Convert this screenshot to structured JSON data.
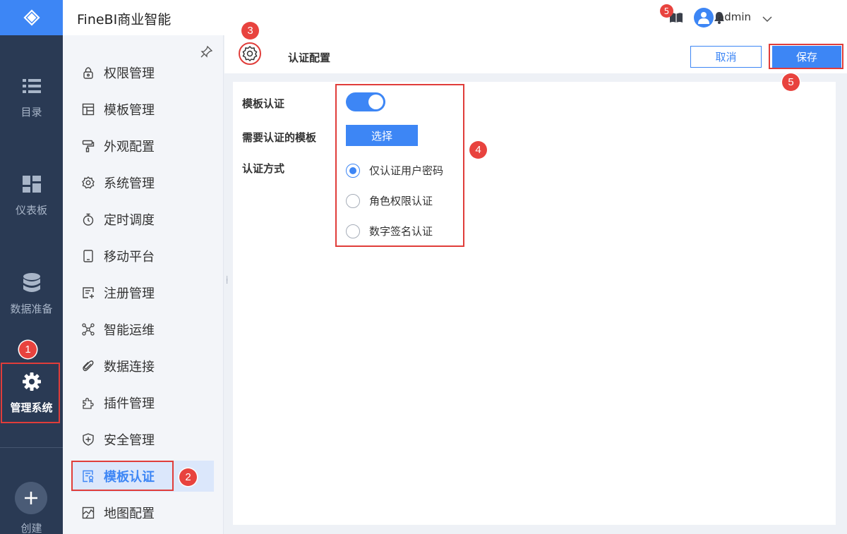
{
  "app_title": "FineBI商业智能",
  "topbar": {
    "notification_count": "5",
    "username": "admin"
  },
  "rail": {
    "items": [
      {
        "label": "目录",
        "icon": "list-icon"
      },
      {
        "label": "仪表板",
        "icon": "dashboard-icon"
      },
      {
        "label": "数据准备",
        "icon": "database-icon"
      },
      {
        "label": "管理系统",
        "icon": "gear-icon",
        "active": true
      }
    ],
    "create_label": "创建"
  },
  "submenu": {
    "items": [
      {
        "label": "权限管理",
        "icon": "lock-icon"
      },
      {
        "label": "模板管理",
        "icon": "template-icon"
      },
      {
        "label": "外观配置",
        "icon": "paint-roller-icon"
      },
      {
        "label": "系统管理",
        "icon": "gear-icon"
      },
      {
        "label": "定时调度",
        "icon": "stopwatch-icon"
      },
      {
        "label": "移动平台",
        "icon": "tablet-icon"
      },
      {
        "label": "注册管理",
        "icon": "register-icon"
      },
      {
        "label": "智能运维",
        "icon": "network-icon"
      },
      {
        "label": "数据连接",
        "icon": "paperclip-icon"
      },
      {
        "label": "插件管理",
        "icon": "puzzle-icon"
      },
      {
        "label": "安全管理",
        "icon": "shield-icon"
      },
      {
        "label": "模板认证",
        "icon": "certificate-icon",
        "active": true
      },
      {
        "label": "地图配置",
        "icon": "map-icon"
      }
    ]
  },
  "content": {
    "title": "认证配置",
    "cancel_label": "取消",
    "save_label": "保存",
    "form": {
      "template_auth_label": "模板认证",
      "template_auth_enabled": true,
      "need_auth_label": "需要认证的模板",
      "select_label": "选择",
      "auth_method_label": "认证方式",
      "auth_methods": [
        {
          "label": "仅认证用户密码",
          "checked": true
        },
        {
          "label": "角色权限认证",
          "checked": false
        },
        {
          "label": "数字签名认证",
          "checked": false
        }
      ]
    }
  },
  "annotations": {
    "steps": [
      "1",
      "2",
      "3",
      "4",
      "5"
    ],
    "color": "#e03d3a"
  },
  "colors": {
    "accent": "#3d86f5",
    "rail_bg": "#2a3a54",
    "badge": "#e8433e"
  }
}
